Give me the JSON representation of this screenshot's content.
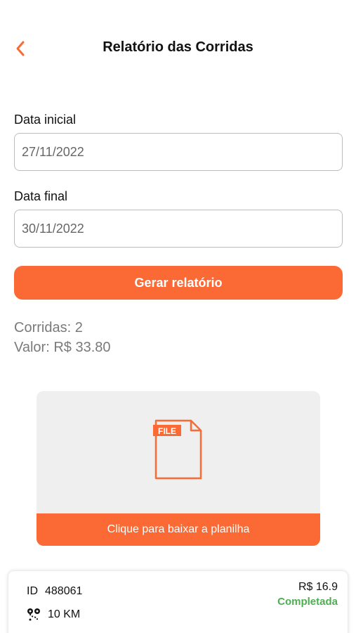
{
  "header": {
    "title": "Relatório das Corridas",
    "back_icon": "chevron-left-icon"
  },
  "form": {
    "start_label": "Data inicial",
    "start_value": "27/11/2022",
    "end_label": "Data final",
    "end_value": "30/11/2022",
    "generate_label": "Gerar relatório"
  },
  "summary": {
    "rides": "Corridas: 2",
    "value": "Valor: R$ 33.80"
  },
  "download": {
    "file_badge": "FILE",
    "label": "Clique para baixar a planilha"
  },
  "rides": [
    {
      "id_label": "ID",
      "id": "488061",
      "distance": "10 KM",
      "price": "R$ 16.9",
      "status": "Completada"
    }
  ],
  "colors": {
    "accent": "#fb6a35",
    "status_completed": "#4caf50"
  }
}
